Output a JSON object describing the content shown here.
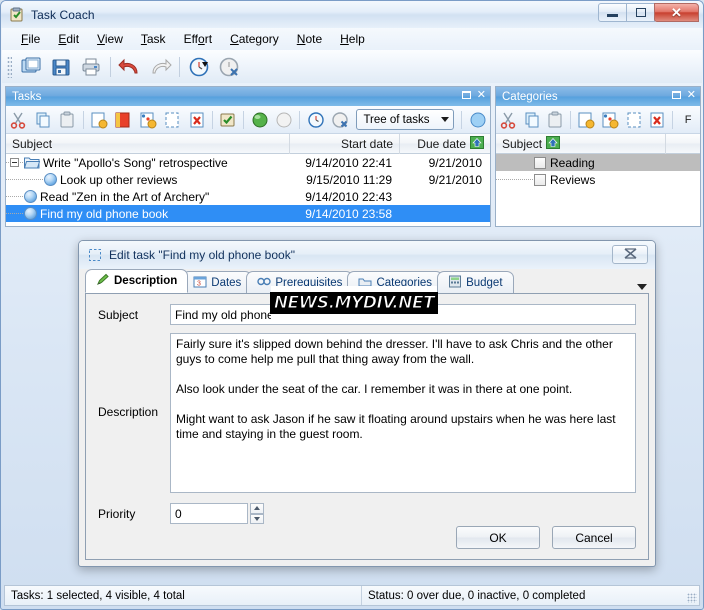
{
  "window": {
    "title": "Task Coach",
    "icon": "taskcoach-icon",
    "buttons": {
      "minimize": "minimize-button",
      "maximize": "maximize-button",
      "close": "close-button",
      "close_glyph": "✕"
    }
  },
  "menubar": {
    "items": [
      {
        "label": "File",
        "mnemonic": "F"
      },
      {
        "label": "Edit",
        "mnemonic": "E"
      },
      {
        "label": "View",
        "mnemonic": "V"
      },
      {
        "label": "Task",
        "mnemonic": "T"
      },
      {
        "label": "Effort",
        "mnemonic": "o"
      },
      {
        "label": "Category",
        "mnemonic": "C"
      },
      {
        "label": "Note",
        "mnemonic": "N"
      },
      {
        "label": "Help",
        "mnemonic": "H"
      }
    ]
  },
  "main_toolbar": {
    "buttons": [
      {
        "name": "open-icon"
      },
      {
        "name": "save-icon"
      },
      {
        "name": "print-icon"
      },
      {
        "name": "undo-icon"
      },
      {
        "name": "redo-icon"
      },
      {
        "name": "start-effort-icon"
      },
      {
        "name": "stop-effort-icon"
      }
    ]
  },
  "tasks_panel": {
    "caption": "Tasks",
    "toolbar_buttons": [
      "cut-icon",
      "copy-icon",
      "paste-icon",
      "new-task-icon",
      "new-subtask-icon",
      "edit-task-icon",
      "mark-incomplete-icon",
      "delete-task-icon",
      "mail-task-icon",
      "priority-up-icon",
      "priority-down-icon",
      "start-tracking-icon",
      "stop-tracking-icon"
    ],
    "view_combo": {
      "value": "Tree of tasks",
      "name": "view-mode-combo"
    },
    "columns": [
      {
        "key": "subject",
        "label": "Subject"
      },
      {
        "key": "start",
        "label": "Start date"
      },
      {
        "key": "due",
        "label": "Due date",
        "sort_icon": "sort-ascending-icon"
      }
    ],
    "rows": [
      {
        "subject": "Write \"Apollo's Song\" retrospective",
        "start": "9/14/2010 22:41",
        "due": "9/21/2010",
        "icon": "folder-open-icon",
        "level": 0,
        "expander": true,
        "selected": false
      },
      {
        "subject": "Look up other reviews",
        "start": "9/15/2010 11:29",
        "due": "9/21/2010",
        "icon": "task-circle-icon",
        "level": 1,
        "expander": false,
        "selected": false
      },
      {
        "subject": "Read \"Zen in the Art of Archery\"",
        "start": "9/14/2010 22:43",
        "due": "",
        "icon": "task-circle-icon",
        "level": 0,
        "expander": false,
        "selected": false
      },
      {
        "subject": "Find my old phone book",
        "start": "9/14/2010 23:58",
        "due": "",
        "icon": "task-circle-icon",
        "level": 0,
        "expander": false,
        "selected": true
      }
    ]
  },
  "categories_panel": {
    "caption": "Categories",
    "toolbar_buttons": [
      "cut-icon",
      "copy-icon",
      "paste-icon",
      "new-category-icon",
      "new-subcategory-icon",
      "edit-category-icon",
      "delete-category-icon"
    ],
    "columns": [
      {
        "key": "subject",
        "label": "Subject",
        "sort_icon": "sort-ascending-icon"
      }
    ],
    "rows": [
      {
        "subject": "Reading",
        "level": 1,
        "checked": false,
        "highlighted": true
      },
      {
        "subject": "Reviews",
        "level": 1,
        "checked": false,
        "highlighted": false
      }
    ]
  },
  "dialog": {
    "title": "Edit task \"Find my old phone book\"",
    "title_icon": "edit-task-icon",
    "close_label": "✕",
    "tabs": [
      {
        "label": "Description",
        "icon": "pencil-icon",
        "active": true
      },
      {
        "label": "Dates",
        "icon": "calendar-icon",
        "active": false
      },
      {
        "label": "Prerequisites",
        "icon": "prerequisites-icon",
        "active": false
      },
      {
        "label": "Categories",
        "icon": "categories-icon",
        "active": false
      },
      {
        "label": "Budget",
        "icon": "budget-icon",
        "active": false
      }
    ],
    "tab_overflow": "tab-overflow-button",
    "subject": {
      "label": "Subject",
      "value": "Find my old phone book"
    },
    "description": {
      "label": "Description",
      "value": "Fairly sure it's slipped down behind the dresser. I'll have to ask Chris and the other guys to come help me pull that thing away from the wall.\n\nAlso look under the seat of the car. I remember it was in there at one point.\n\nMight want to ask Jason if he saw it floating around upstairs when he was here last time and staying in the guest room."
    },
    "priority": {
      "label": "Priority",
      "value": "0"
    },
    "ok_label": "OK",
    "cancel_label": "Cancel"
  },
  "statusbar": {
    "left": "Tasks: 1 selected, 4 visible, 4 total",
    "right": "Status: 0 over due, 0 inactive, 0 completed"
  },
  "watermark": {
    "text": "NEWS.MYDIV.NET"
  },
  "colors": {
    "selection": "#2f8ef5",
    "caption": "#6ba7de",
    "close_red": "#c8402f"
  }
}
